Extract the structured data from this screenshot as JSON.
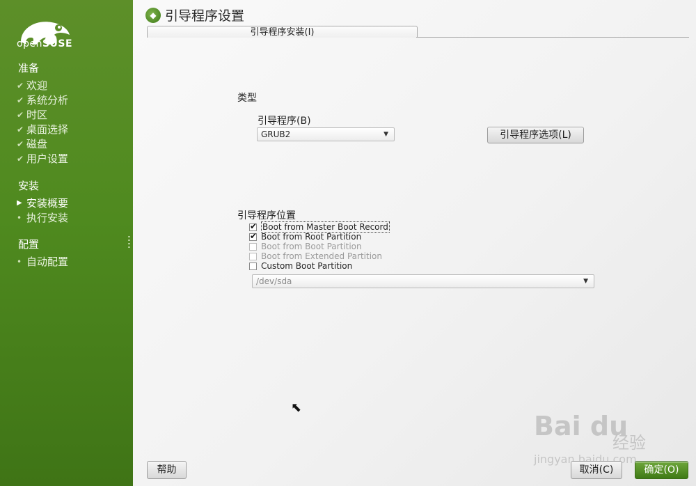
{
  "brand": {
    "name_light": "open",
    "name_bold": "SUSE"
  },
  "sidebar": {
    "sections": [
      {
        "title": "准备",
        "items": [
          {
            "label": "欢迎",
            "state": "done"
          },
          {
            "label": "系统分析",
            "state": "done"
          },
          {
            "label": "时区",
            "state": "done"
          },
          {
            "label": "桌面选择",
            "state": "done"
          },
          {
            "label": "磁盘",
            "state": "done"
          },
          {
            "label": "用户设置",
            "state": "done"
          }
        ]
      },
      {
        "title": "安装",
        "items": [
          {
            "label": "安装概要",
            "state": "current"
          },
          {
            "label": "执行安装",
            "state": "pending"
          }
        ]
      },
      {
        "title": "配置",
        "items": [
          {
            "label": "自动配置",
            "state": "pending"
          }
        ]
      }
    ]
  },
  "header": {
    "title": "引导程序设置",
    "icon": "opensuse-gecko-icon"
  },
  "tab": {
    "label": "引导程序安装(I)"
  },
  "type_section": {
    "title": "类型",
    "bootloader_label": "引导程序(B)",
    "bootloader_value": "GRUB2",
    "options_button": "引导程序选项(L)"
  },
  "location_section": {
    "title": "引导程序位置",
    "options": [
      {
        "label": "Boot from Master Boot Record",
        "checked": true,
        "enabled": true,
        "focused": true
      },
      {
        "label": "Boot from Root Partition",
        "checked": true,
        "enabled": true
      },
      {
        "label": "Boot from Boot Partition",
        "checked": false,
        "enabled": false
      },
      {
        "label": "Boot from Extended Partition",
        "checked": false,
        "enabled": false
      },
      {
        "label": "Custom Boot Partition",
        "checked": false,
        "enabled": true
      }
    ],
    "custom_partition_value": "/dev/sda"
  },
  "footer": {
    "help_button": "帮助",
    "cancel_button": "取消(C)",
    "ok_button": "确定(O)"
  },
  "watermark": {
    "logo": "Bai du",
    "cn": "经验",
    "url": "jingyan.baidu.com"
  },
  "colors": {
    "sidebar_green": "#4f8a1f",
    "ok_green": "#3f7a16"
  }
}
